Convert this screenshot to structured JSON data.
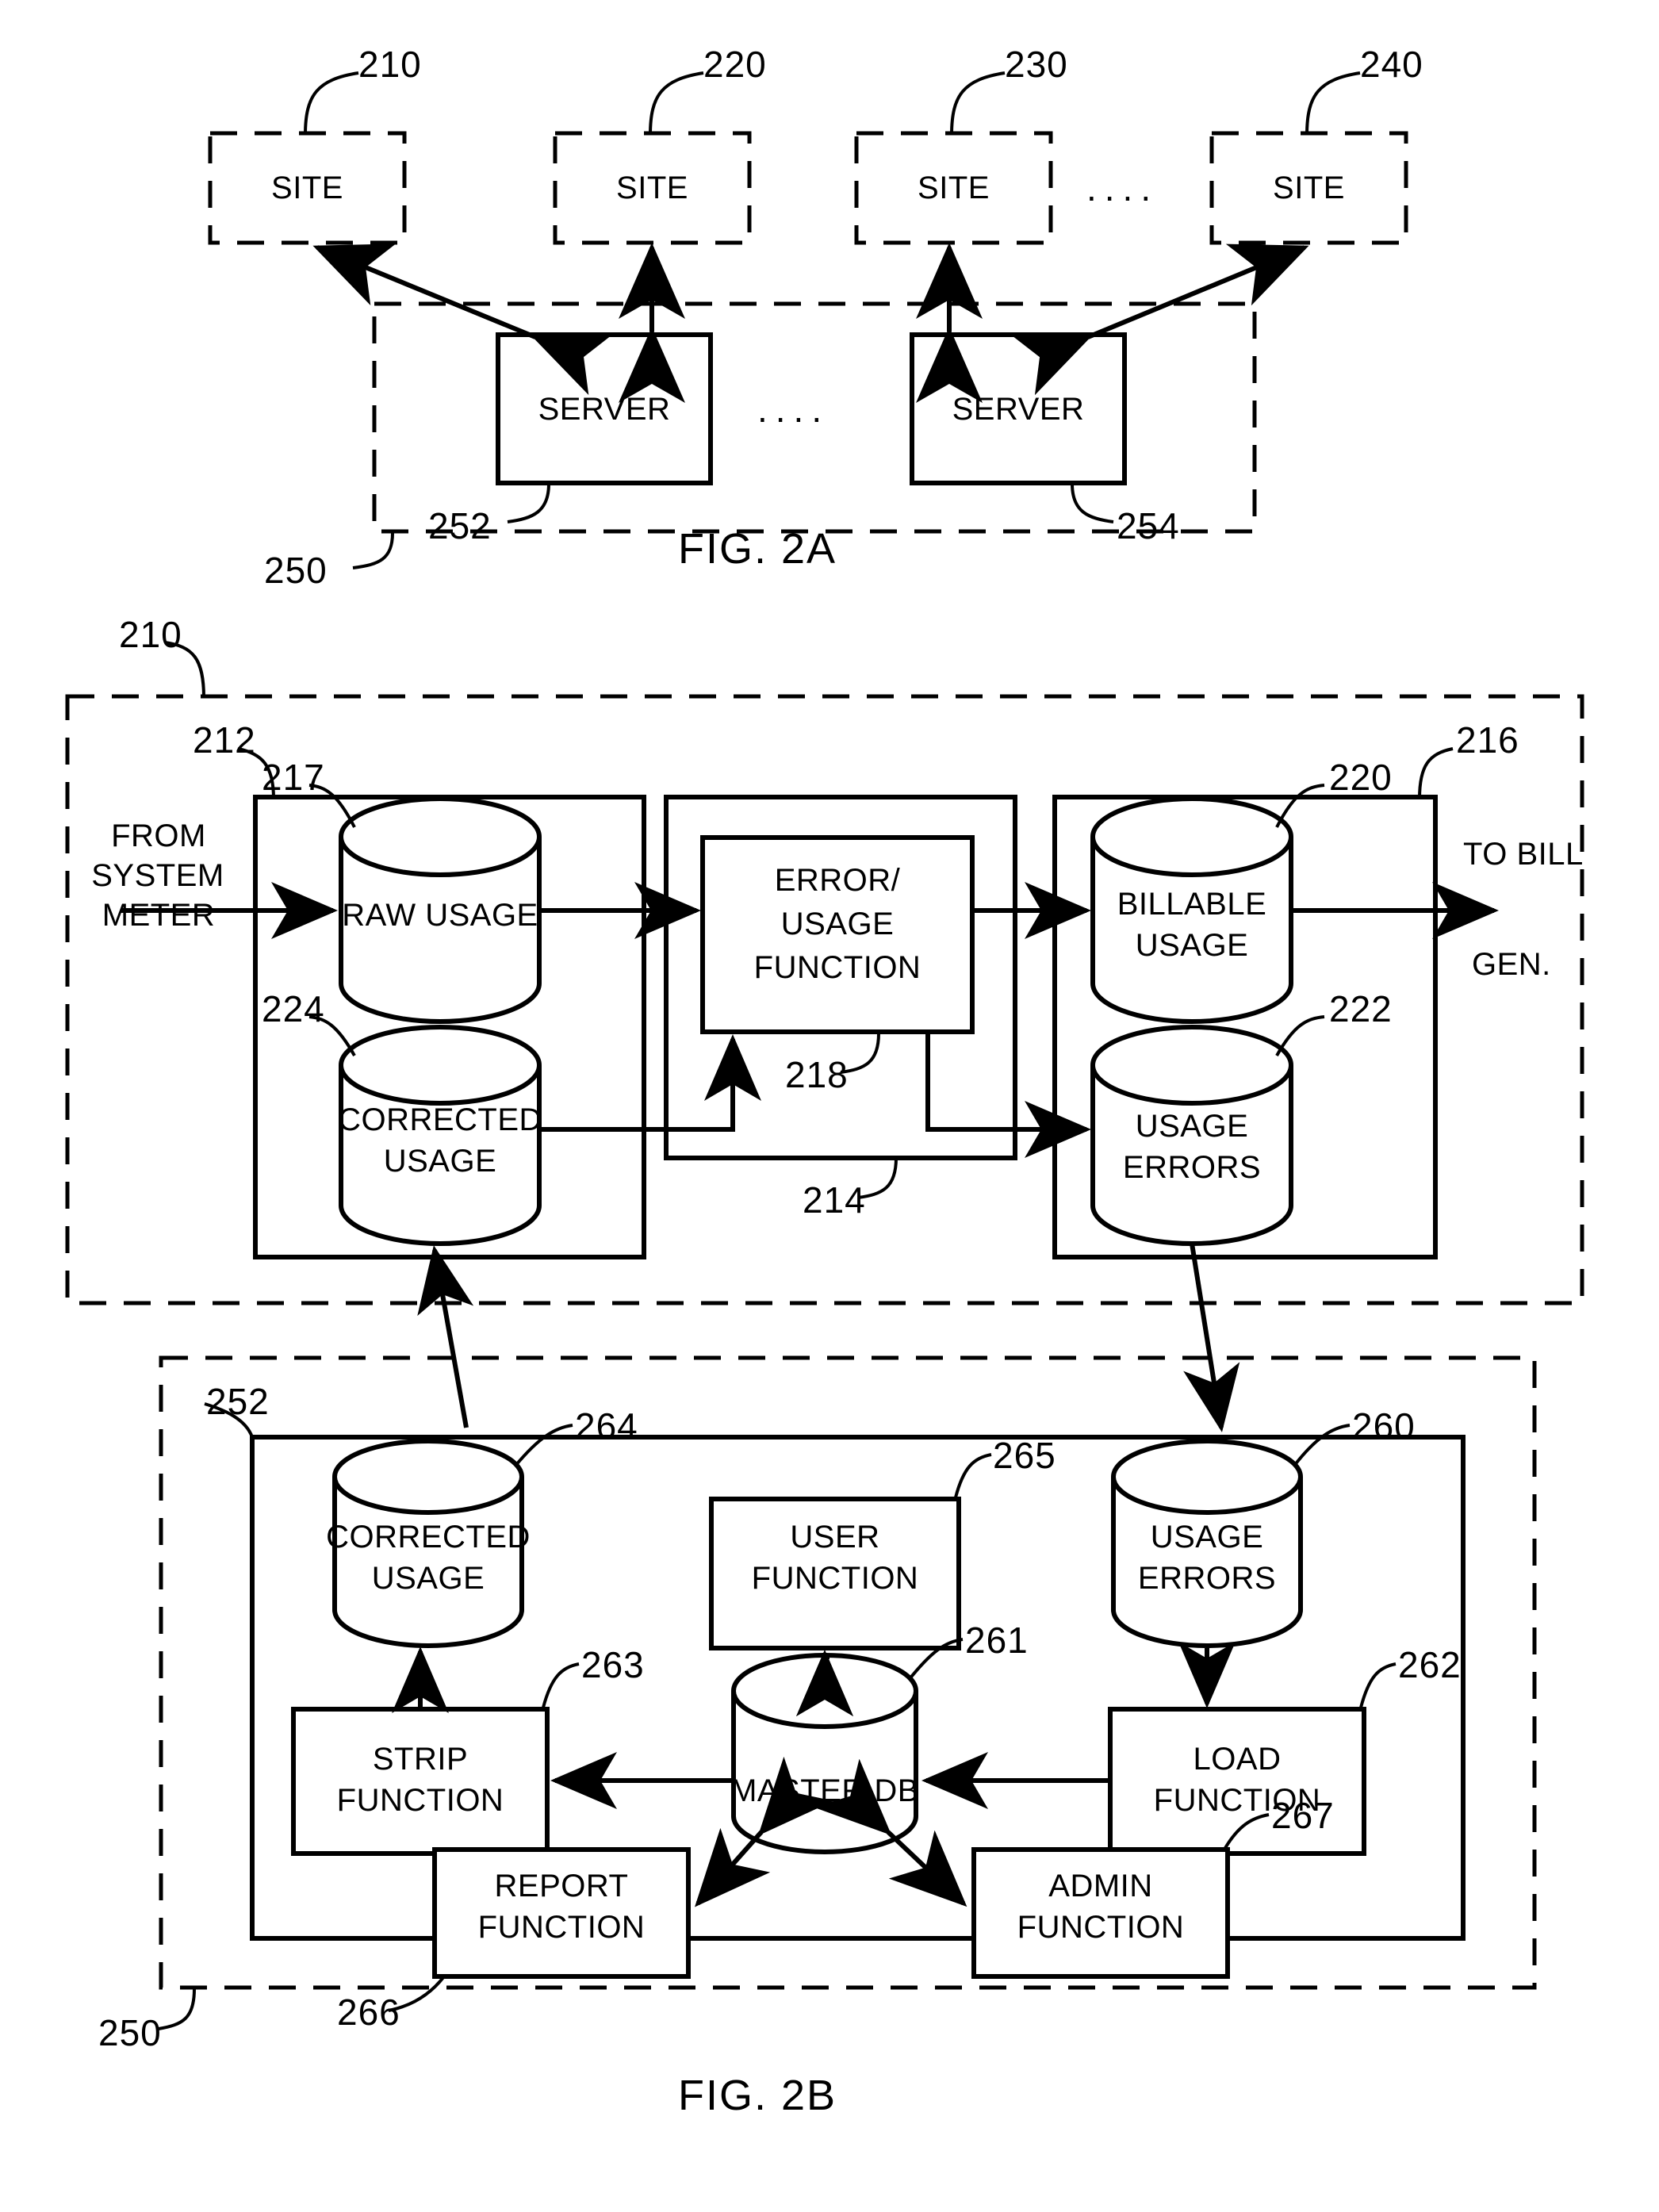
{
  "figures": [
    {
      "caption": "FIG. 2A",
      "sites": [
        {
          "label": "SITE",
          "ref": "210"
        },
        {
          "label": "SITE",
          "ref": "220"
        },
        {
          "label": "SITE",
          "ref": "230"
        },
        {
          "label": "SITE",
          "ref": "240"
        }
      ],
      "site_ellipsis": "....",
      "server_group_ref": "250",
      "servers": [
        {
          "label": "SERVER",
          "ref": "252"
        },
        {
          "label": "SERVER",
          "ref": "254"
        }
      ],
      "server_ellipsis": "...."
    },
    {
      "caption": "FIG. 2B",
      "site_block": {
        "ref": "210",
        "input_label_line1": "FROM",
        "input_label_line2": "SYSTEM",
        "input_label_line3": "METER",
        "output_label_line1": "TO BILL",
        "output_label_line2": "GEN.",
        "left_group_ref": "212",
        "middle_group_ref": "214",
        "right_group_ref": "216",
        "nodes": [
          {
            "name": "raw-usage",
            "label_line1": "RAW USAGE",
            "label_line2": "",
            "ref": "217",
            "shape": "cylinder"
          },
          {
            "name": "corrected-usage",
            "label_line1": "CORRECTED",
            "label_line2": "USAGE",
            "ref": "224",
            "shape": "cylinder"
          },
          {
            "name": "error-usage-function",
            "label_line1": "ERROR/",
            "label_line2": "USAGE",
            "label_line3": "FUNCTION",
            "ref": "218",
            "shape": "box"
          },
          {
            "name": "billable-usage",
            "label_line1": "BILLABLE",
            "label_line2": "USAGE",
            "ref": "220",
            "shape": "cylinder"
          },
          {
            "name": "usage-errors",
            "label_line1": "USAGE",
            "label_line2": "ERRORS",
            "ref": "222",
            "shape": "cylinder"
          }
        ]
      },
      "server_block": {
        "ref": "252",
        "outer_ref": "250",
        "nodes": [
          {
            "name": "corrected-usage",
            "label_line1": "CORRECTED",
            "label_line2": "USAGE",
            "ref": "264",
            "shape": "cylinder"
          },
          {
            "name": "user-function",
            "label_line1": "USER",
            "label_line2": "FUNCTION",
            "ref": "265",
            "shape": "box"
          },
          {
            "name": "usage-errors",
            "label_line1": "USAGE",
            "label_line2": "ERRORS",
            "ref": "260",
            "shape": "cylinder"
          },
          {
            "name": "strip-function",
            "label_line1": "STRIP",
            "label_line2": "FUNCTION",
            "ref": "263",
            "shape": "box"
          },
          {
            "name": "master-db",
            "label_line1": "MASTER DB",
            "label_line2": "",
            "ref": "261",
            "shape": "cylinder"
          },
          {
            "name": "load-function",
            "label_line1": "LOAD",
            "label_line2": "FUNCTION",
            "ref": "262",
            "shape": "box"
          },
          {
            "name": "report-function",
            "label_line1": "REPORT",
            "label_line2": "FUNCTION",
            "ref": "266",
            "shape": "box"
          },
          {
            "name": "admin-function",
            "label_line1": "ADMIN",
            "label_line2": "FUNCTION",
            "ref": "267",
            "shape": "box"
          }
        ]
      }
    }
  ],
  "colors": {
    "ink": "#000000",
    "paper": "#ffffff"
  }
}
